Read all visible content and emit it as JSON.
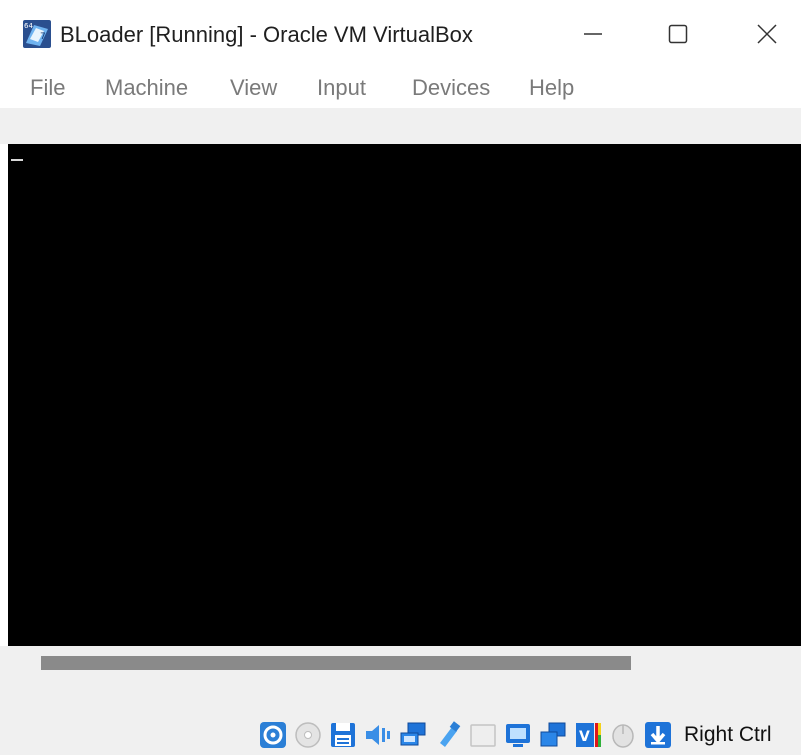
{
  "window": {
    "title": "BLoader [Running] - Oracle VM VirtualBox"
  },
  "menu": {
    "items": [
      "File",
      "Machine",
      "View",
      "Input",
      "Devices",
      "Help"
    ]
  },
  "status_bar": {
    "icons": [
      "hard-disk-icon",
      "optical-drive-icon",
      "floppy-drive-icon",
      "audio-icon",
      "network-icon",
      "usb-icon",
      "shared-folders-icon",
      "display-icon",
      "recording-icon",
      "virtualization-engine-icon",
      "mouse-integration-icon",
      "keyboard-capture-icon"
    ],
    "host_key": "Right Ctrl"
  },
  "colors": {
    "accent_blue": "#1e73d8",
    "screen": "#000000",
    "menu_text": "#7a7a7a",
    "chrome_gray": "#f0f0f0"
  }
}
